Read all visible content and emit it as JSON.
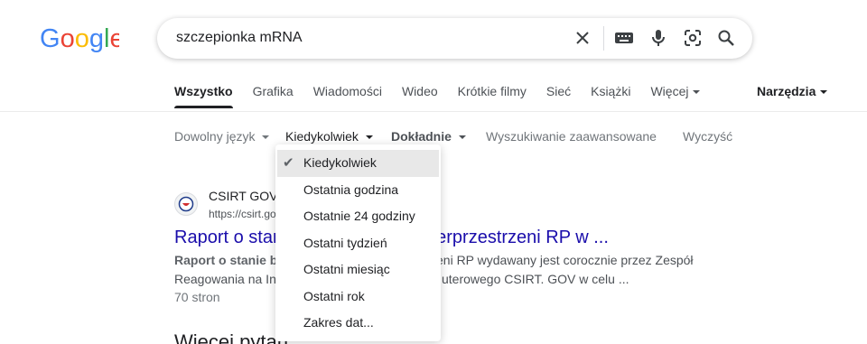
{
  "brand": {
    "logo_text": "Google"
  },
  "search": {
    "query": "szczepionka mRNA"
  },
  "tabs": [
    {
      "label": "Wszystko",
      "active": true
    },
    {
      "label": "Grafika"
    },
    {
      "label": "Wiadomości"
    },
    {
      "label": "Wideo"
    },
    {
      "label": "Krótkie filmy"
    },
    {
      "label": "Sieć"
    },
    {
      "label": "Książki"
    },
    {
      "label": "Więcej"
    }
  ],
  "tools_label": "Narzędzia",
  "toolbar": {
    "language": "Dowolny język",
    "time": "Kiedykolwiek",
    "exact": "Dokładnie",
    "advanced": "Wyszukiwanie zaawansowane",
    "clear": "Wyczyść"
  },
  "time_menu": {
    "items": [
      {
        "label": "Kiedykolwiek",
        "selected": true
      },
      {
        "label": "Ostatnia godzina"
      },
      {
        "label": "Ostatnie 24 godziny"
      },
      {
        "label": "Ostatni tydzień"
      },
      {
        "label": "Ostatni miesiąc"
      },
      {
        "label": "Ostatni rok"
      },
      {
        "label": "Zakres dat..."
      }
    ]
  },
  "result": {
    "site_name": "CSIRT GOV",
    "url": "https://csirt.gov",
    "title_start": "Raport o stan",
    "title_end": "berprzestrzeni RP w ...",
    "snippet_line1_start": "Raport o stanie be",
    "snippet_line1_end": "eni RP wydawany jest corocznie przez Zespół",
    "snippet_line2_start": "Reagowania na Inc",
    "snippet_line2_end": "uterowego CSIRT. GOV w celu ...",
    "pages": "70 stron"
  },
  "more_heading": "Więcej pytań",
  "colors": {
    "link": "#1a0dab",
    "text": "#202124",
    "muted": "#4d5156"
  },
  "icons": [
    "clear-icon",
    "keyboard-icon",
    "microphone-icon",
    "lens-icon",
    "search-icon",
    "checkmark-icon"
  ]
}
